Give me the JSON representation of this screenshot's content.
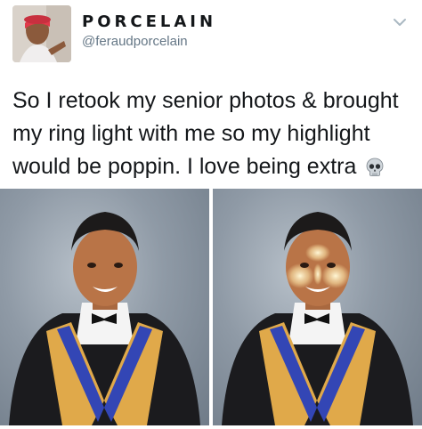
{
  "tweet": {
    "display_name": "PORCELAIN",
    "handle": "@feraudporcelain",
    "text_lines": [
      "So I retook my senior photos & brought",
      "my ring light with me so my highlight",
      "would be poppin. I love being extra"
    ]
  },
  "icons": {
    "menu": "chevron-down-icon",
    "emoji": "skull-emoji"
  },
  "media": {
    "photos": [
      {
        "name": "senior-photo-original",
        "highlight": false
      },
      {
        "name": "senior-photo-ring-light",
        "highlight": true
      }
    ]
  },
  "colors": {
    "handle": "#657786",
    "text": "#14171a",
    "gown": "#1b1b1e",
    "stole_gold": "#e0a94a",
    "stole_blue": "#3346b5"
  }
}
